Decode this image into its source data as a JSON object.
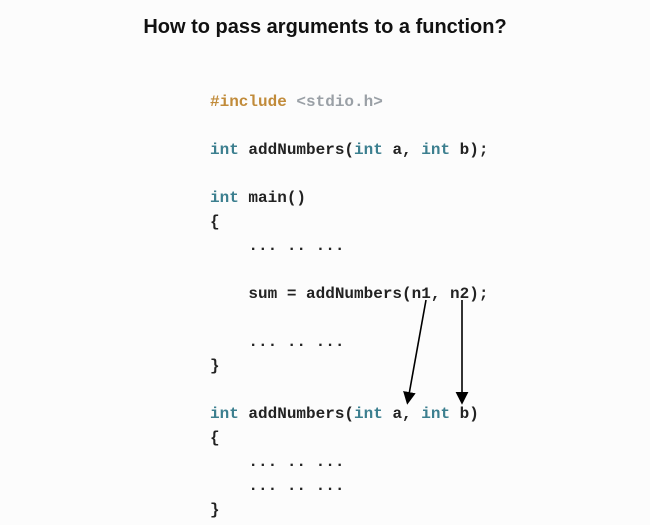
{
  "title": "How to pass arguments to a function?",
  "code": {
    "include_directive": "#include",
    "include_header": "<stdio.h>",
    "kw_int_1": "int",
    "proto_name": " addNumbers(",
    "kw_int_proto_a": "int",
    "proto_a": " a, ",
    "kw_int_proto_b": "int",
    "proto_b": " b);",
    "kw_int_main": "int",
    "main_sig": " main()",
    "brace_open_1": "{",
    "ellipsis_1": "    ... .. ...",
    "call_line_indent": "    sum = addNumbers(n1, n2);",
    "ellipsis_2": "    ... .. ...",
    "brace_close_1": "}",
    "kw_int_def": "int",
    "def_name": " addNumbers(",
    "kw_int_def_a": "int",
    "def_a": " a, ",
    "kw_int_def_b": "int",
    "def_b": " b)",
    "brace_open_2": "{",
    "ellipsis_3": "    ... .. ...",
    "ellipsis_4": "    ... .. ...",
    "brace_close_2": "}"
  }
}
